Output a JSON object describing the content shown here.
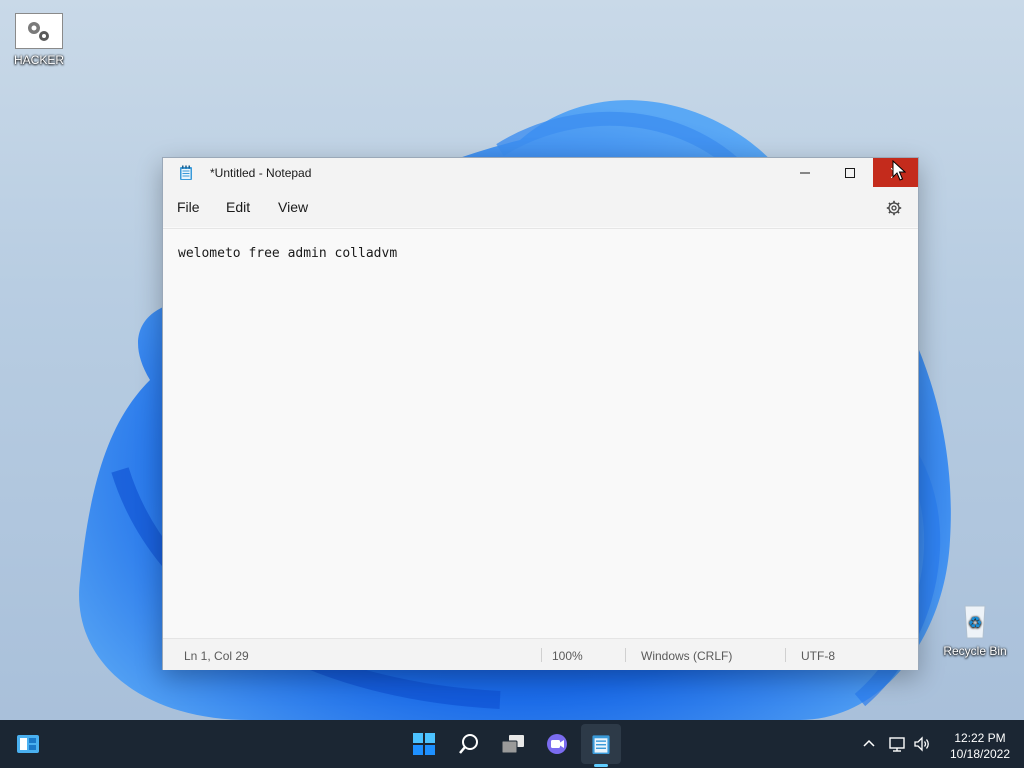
{
  "desktop": {
    "icons": [
      {
        "label": "HACKER",
        "icon": "settings-gears-icon"
      },
      {
        "label": "Recycle Bin",
        "icon": "recycle-bin-icon"
      }
    ]
  },
  "notepad": {
    "title": "*Untitled - Notepad",
    "menu": {
      "file": "File",
      "edit": "Edit",
      "view": "View"
    },
    "content": "welometo free admin colladvm",
    "status": {
      "position": "Ln 1, Col 29",
      "zoom": "100%",
      "line_ending": "Windows (CRLF)",
      "encoding": "UTF-8"
    }
  },
  "taskbar": {
    "buttons": [
      "widgets",
      "start",
      "search",
      "task-view",
      "chat",
      "notepad"
    ],
    "clock": {
      "time": "12:22 PM",
      "date": "10/18/2022"
    }
  },
  "colors": {
    "close_hover": "#c42b1c",
    "taskbar": "#1b2633",
    "accent": "#60cdff"
  }
}
